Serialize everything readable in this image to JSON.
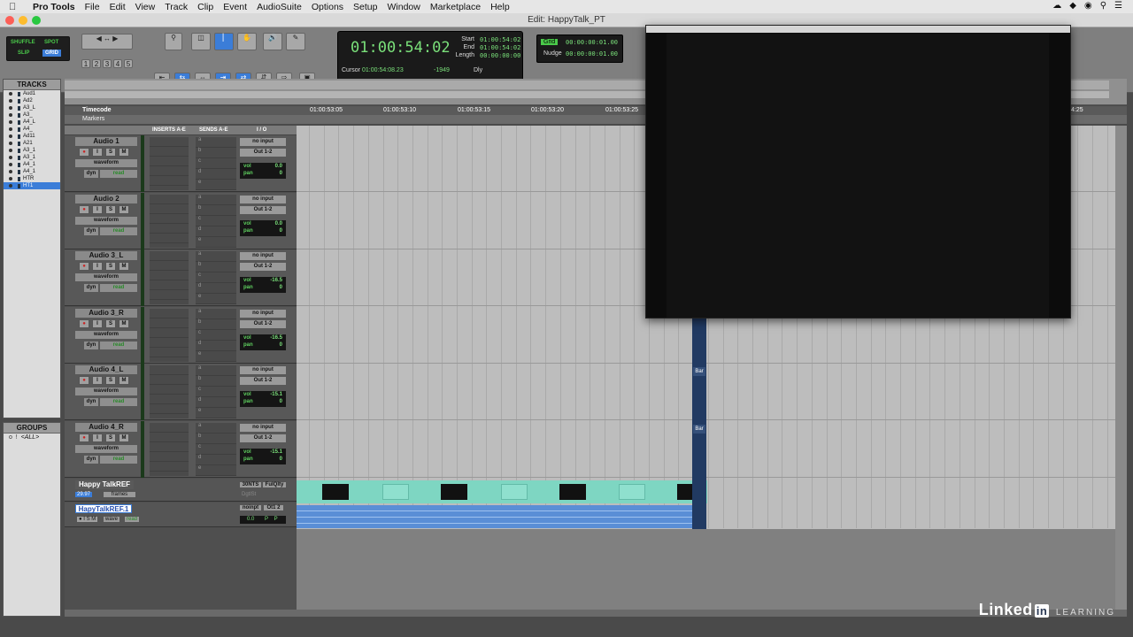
{
  "menubar": {
    "app": "Pro Tools",
    "items": [
      "File",
      "Edit",
      "View",
      "Track",
      "Clip",
      "Event",
      "AudioSuite",
      "Options",
      "Setup",
      "Window",
      "Marketplace",
      "Help"
    ]
  },
  "window": {
    "title": "Edit: HappyTalk_PT"
  },
  "toolbar": {
    "modes": {
      "shuffle": "SHUFFLE",
      "spot": "SPOT",
      "slip": "SLIP",
      "grid": "GRID"
    },
    "zoom_presets": [
      "1",
      "2",
      "3",
      "4",
      "5"
    ],
    "counter": {
      "main": "01:00:54:02",
      "start_label": "Start",
      "end_label": "End",
      "length_label": "Length",
      "start": "01:00:54:02",
      "end": "01:00:54:02",
      "length": "00:00:00:00",
      "cursor_label": "Cursor",
      "cursor": "01:00:54:08.23",
      "nudge_val": "-1949",
      "dly": "Dly"
    },
    "grid": {
      "grid_label": "Grid",
      "grid_value": "00:00:00:01.00",
      "nudge_label": "Nudge",
      "nudge_value": "00:00:00:01.00"
    }
  },
  "tracks_panel": {
    "title": "TRACKS",
    "items": [
      "Aud1",
      "Ad2",
      "A3_L",
      "A3_",
      "A4_L",
      "A4_",
      "Ad11",
      "A21",
      "A3_1",
      "A3_1",
      "A4_1",
      "A4_1",
      "HTR",
      "HT1"
    ]
  },
  "groups_panel": {
    "title": "GROUPS",
    "all": "<ALL>"
  },
  "rulers": {
    "timecode_label": "Timecode",
    "markers_label": "Markers",
    "ticks": [
      "01:00:53:05",
      "01:00:53:10",
      "01:00:53:15",
      "01:00:53:20",
      "01:00:53:25"
    ],
    "tick_right": "4:25"
  },
  "columns": {
    "inserts": "INSERTS A-E",
    "sends": "SENDS A-E",
    "io": "I / O"
  },
  "tracks": [
    {
      "name": "Audio 1",
      "view": "waveform",
      "dyn": "dyn",
      "auto": "read",
      "input": "no input",
      "output": "Out 1-2",
      "vol": "0.0",
      "pan": "0"
    },
    {
      "name": "Audio 2",
      "view": "waveform",
      "dyn": "dyn",
      "auto": "read",
      "input": "no input",
      "output": "Out 1-2",
      "vol": "0.0",
      "pan": "0"
    },
    {
      "name": "Audio 3_L",
      "view": "waveform",
      "dyn": "dyn",
      "auto": "read",
      "input": "no input",
      "output": "Out 1-2",
      "vol": "-16.5",
      "pan": "0"
    },
    {
      "name": "Audio 3_R",
      "view": "waveform",
      "dyn": "dyn",
      "auto": "read",
      "input": "no input",
      "output": "Out 1-2",
      "vol": "-16.5",
      "pan": "0"
    },
    {
      "name": "Audio 4_L",
      "view": "waveform",
      "dyn": "dyn",
      "auto": "read",
      "input": "no input",
      "output": "Out 1-2",
      "vol": "-15.1",
      "pan": "0"
    },
    {
      "name": "Audio 4_R",
      "view": "waveform",
      "dyn": "dyn",
      "auto": "read",
      "input": "no input",
      "output": "Out 1-2",
      "vol": "-15.1",
      "pan": "0"
    }
  ],
  "track_buttons": {
    "rec": "●",
    "input": "I",
    "solo": "S",
    "mute": "M"
  },
  "video_track": {
    "name": "Happy TalkREF",
    "fps": "29.97",
    "view": "frames",
    "format": "30NTS",
    "quality": "FulQlty",
    "sub": "DgtlSt"
  },
  "audio_ref_track": {
    "name": "HapyTalkREF.1",
    "view": "wave",
    "auto": "read",
    "input": "noinpt",
    "output": "Ot1 2",
    "vol": "0.0",
    "pan_l": "P",
    "pan_r": "P"
  },
  "markers": {
    "bar_label": "Bar"
  },
  "watermark": {
    "brand": "Linked",
    "in": "in",
    "learning": "LEARNING"
  }
}
